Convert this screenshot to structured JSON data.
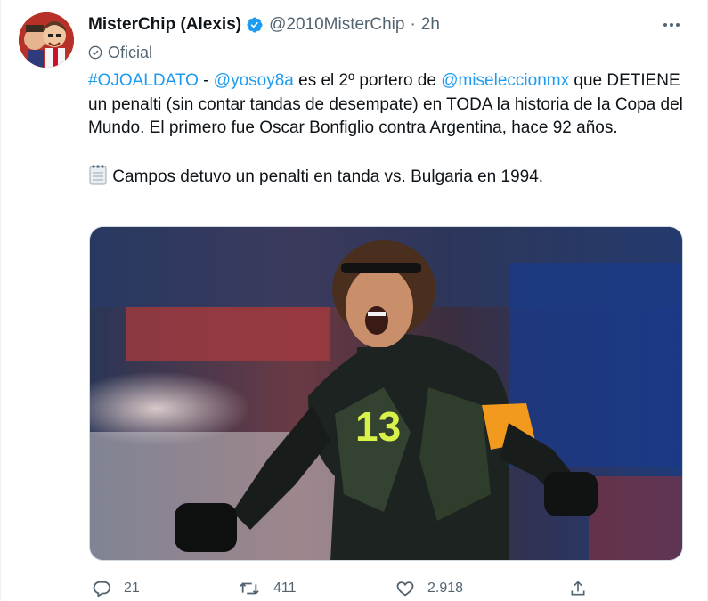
{
  "tweet": {
    "author": {
      "display_name": "MisterChip (Alexis)",
      "handle": "@2010MisterChip",
      "verified": true,
      "label": "Oficial",
      "avatar_icon": "avatar-caricature"
    },
    "separator": "·",
    "time": "2h",
    "body": {
      "hashtag": "#OJOALDATO",
      "dash": " - ",
      "mention_1": "@yosoy8a",
      "text_1": " es el 2º portero de ",
      "mention_2": "@miseleccionmx",
      "text_2": " que DETIENE un penalti (sin contar tandas de desempate) en TODA la historia de la Copa del Mundo. El primero fue Oscar Bonfiglio contra Argentina, hace 92 años.",
      "notepad_icon": "spiral-notepad-emoji",
      "text_3": " Campos detuvo un penalti en tanda vs. Bulgaria en 1994."
    },
    "media": {
      "description_icon": "photo-goalkeeper-celebrating",
      "jersey_number": "13"
    },
    "actions": {
      "reply_count": "21",
      "retweet_count": "411",
      "like_count": "2.918"
    },
    "colors": {
      "link": "#1d9bf0",
      "verified": "#1d9bf0",
      "secondary": "#536471",
      "text": "#0f1419"
    }
  }
}
